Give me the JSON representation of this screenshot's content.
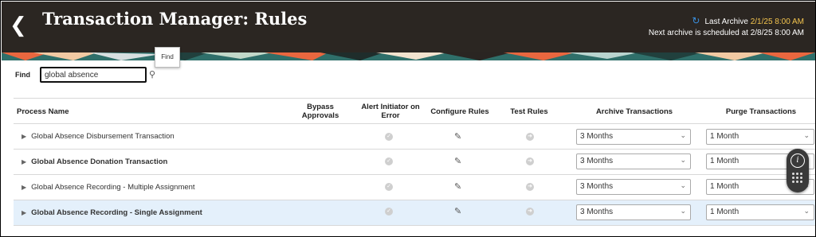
{
  "header": {
    "title": "Transaction Manager: Rules",
    "last_archive_label": "Last Archive",
    "last_archive_value": "2/1/25 8:00 AM",
    "next_archive_text": "Next archive is scheduled at 2/8/25 8:00 AM"
  },
  "colors": {
    "header_bg": "#2b2622",
    "highlight": "#f3c44e",
    "selected_row": "#e4f0fb"
  },
  "find": {
    "label": "Find",
    "value": "global absence",
    "tooltip": "Find"
  },
  "columns": {
    "process_name": "Process Name",
    "bypass_approvals": "Bypass Approvals",
    "alert_initiator": "Alert Initiator on Error",
    "configure_rules": "Configure Rules",
    "test_rules": "Test Rules",
    "archive_transactions": "Archive Transactions",
    "purge_transactions": "Purge Transactions"
  },
  "rows": [
    {
      "name": "Global Absence Disbursement Transaction",
      "archive": "3 Months",
      "purge": "1 Month",
      "bold": false
    },
    {
      "name": "Global Absence Donation Transaction",
      "archive": "3 Months",
      "purge": "1 Month",
      "bold": true
    },
    {
      "name": "Global Absence Recording - Multiple Assignment",
      "archive": "3 Months",
      "purge": "1 Month",
      "bold": false
    },
    {
      "name": "Global Absence Recording - Single Assignment",
      "archive": "3 Months",
      "purge": "1 Month",
      "bold": true,
      "selected": true
    }
  ]
}
